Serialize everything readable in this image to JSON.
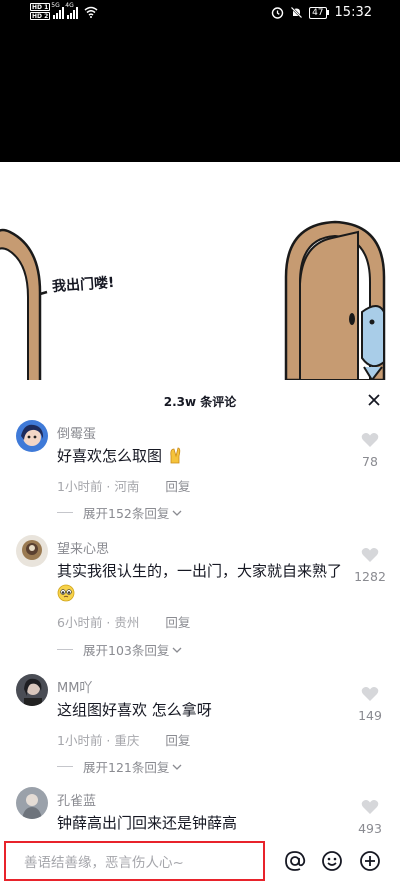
{
  "status_bar": {
    "hd1": "HD 1",
    "hd2": "HD 2",
    "net1": "5G",
    "net2": "4G",
    "battery": "47",
    "time": "15:32",
    "icons": [
      "alarm-icon",
      "mute-icon",
      "wifi-icon",
      "signal-icon"
    ]
  },
  "video": {
    "caption": "我出门喽!",
    "background": "#000000"
  },
  "comments_panel": {
    "title": "2.3w 条评论",
    "close_icon": "close-icon",
    "comments": [
      {
        "user": "倒霉蛋",
        "text": "好喜欢怎么取图",
        "emoji": "fingers-crossed-emoji",
        "time": "1小时前",
        "location": "河南",
        "reply_label": "回复",
        "expand_label": "展开152条回复",
        "likes": "78"
      },
      {
        "user": "望来心思",
        "text": "其实我很认生的，一出门，大家就自来熟了",
        "emoji": "pleading-face-emoji",
        "time": "6小时前",
        "location": "贵州",
        "reply_label": "回复",
        "expand_label": "展开103条回复",
        "likes": "1282"
      },
      {
        "user": "MM吖",
        "text": "这组图好喜欢 怎么拿呀",
        "time": "1小时前",
        "location": "重庆",
        "reply_label": "回复",
        "expand_label": "展开121条回复",
        "likes": "149"
      },
      {
        "user": "孔雀蓝",
        "text": "钟薛高出门回来还是钟薛高",
        "likes": "493"
      }
    ]
  },
  "input_bar": {
    "placeholder": "善语结善缘，恶言伤人心~",
    "icons": [
      "at-icon",
      "emoji-icon",
      "add-icon"
    ]
  },
  "colors": {
    "accent_red": "#e8232b",
    "text_primary": "#161823",
    "text_secondary": "#8a8b91"
  }
}
